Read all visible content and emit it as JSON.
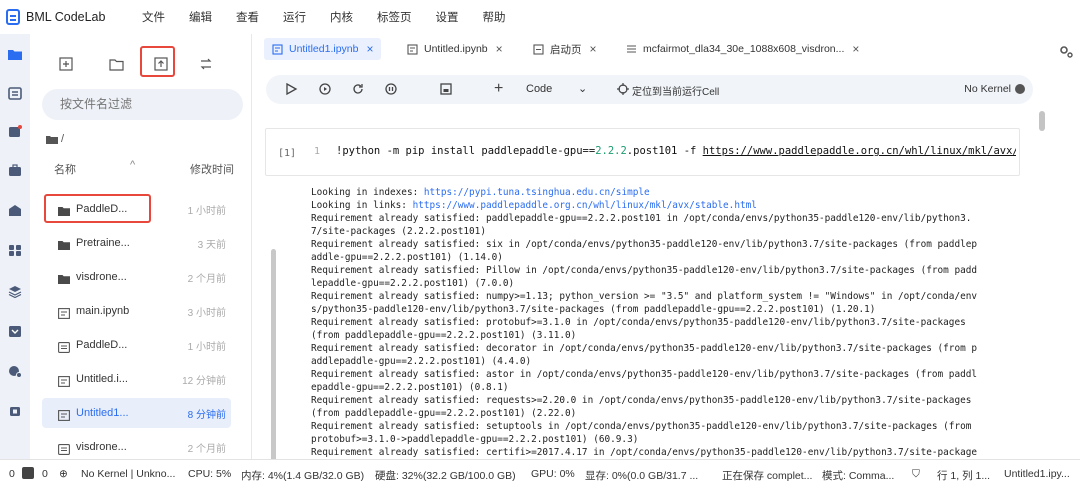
{
  "app": {
    "title": "BML CodeLab"
  },
  "menu": [
    "文件",
    "编辑",
    "查看",
    "运行",
    "内核",
    "标签页",
    "设置",
    "帮助"
  ],
  "filepanel": {
    "filter_placeholder": "按文件名过滤",
    "breadcrumb": "/",
    "col_name": "名称",
    "col_modified": "修改时间",
    "files": [
      {
        "name": "PaddleD...",
        "modified": "1 小时前",
        "type": "folder"
      },
      {
        "name": "Pretraine...",
        "modified": "3 天前",
        "type": "folder"
      },
      {
        "name": "visdrone...",
        "modified": "2 个月前",
        "type": "folder"
      },
      {
        "name": "main.ipynb",
        "modified": "3 小时前",
        "type": "notebook"
      },
      {
        "name": "PaddleD...",
        "modified": "1 小时前",
        "type": "document"
      },
      {
        "name": "Untitled.i...",
        "modified": "12 分钟前",
        "type": "notebook"
      },
      {
        "name": "Untitled1...",
        "modified": "8 分钟前",
        "type": "notebook",
        "selected": true
      },
      {
        "name": "visdrone...",
        "modified": "2 个月前",
        "type": "document"
      }
    ]
  },
  "tabs": [
    {
      "label": "Untitled1.ipynb",
      "active": true,
      "icon": "notebook-icon"
    },
    {
      "label": "Untitled.ipynb",
      "icon": "notebook-icon"
    },
    {
      "label": "启动页",
      "icon": "launcher-icon"
    },
    {
      "label": "mcfairmot_dla34_30e_1088x608_visdron...",
      "icon": "text-file-icon"
    }
  ],
  "toolbar": {
    "cell_type": "Code",
    "locate_label": "定位到当前运行Cell",
    "kernel": "No Kernel"
  },
  "cell": {
    "prompt": "[1]",
    "line_no": "1",
    "code_pre": "!python -m pip install paddlepaddle-gpu==",
    "code_num": "2.2.2",
    "code_mid": ".post101 -f ",
    "code_url": "https://www.paddlepaddle.org.cn/whl/linux/mkl/avx/stabl"
  },
  "output": [
    {
      "pre": "Looking in indexes: ",
      "link": "https://pypi.tuna.tsinghua.edu.cn/simple"
    },
    {
      "pre": "Looking in links: ",
      "link": "https://www.paddlepaddle.org.cn/whl/linux/mkl/avx/stable.html"
    },
    {
      "pre": "Requirement already satisfied: paddlepaddle-gpu==2.2.2.post101 in /opt/conda/envs/python35-paddle120-env/lib/python3."
    },
    {
      "pre": "7/site-packages (2.2.2.post101)"
    },
    {
      "pre": "Requirement already satisfied: six in /opt/conda/envs/python35-paddle120-env/lib/python3.7/site-packages (from paddlep"
    },
    {
      "pre": "addle-gpu==2.2.2.post101) (1.14.0)"
    },
    {
      "pre": "Requirement already satisfied: Pillow in /opt/conda/envs/python35-paddle120-env/lib/python3.7/site-packages (from padd"
    },
    {
      "pre": "lepaddle-gpu==2.2.2.post101) (7.0.0)"
    },
    {
      "pre": "Requirement already satisfied: numpy>=1.13; python_version >= \"3.5\" and platform_system != \"Windows\" in /opt/conda/env"
    },
    {
      "pre": "s/python35-paddle120-env/lib/python3.7/site-packages (from paddlepaddle-gpu==2.2.2.post101) (1.20.1)"
    },
    {
      "pre": "Requirement already satisfied: protobuf>=3.1.0 in /opt/conda/envs/python35-paddle120-env/lib/python3.7/site-packages"
    },
    {
      "pre": "(from paddlepaddle-gpu==2.2.2.post101) (3.11.0)"
    },
    {
      "pre": "Requirement already satisfied: decorator in /opt/conda/envs/python35-paddle120-env/lib/python3.7/site-packages (from p"
    },
    {
      "pre": "addlepaddle-gpu==2.2.2.post101) (4.4.0)"
    },
    {
      "pre": "Requirement already satisfied: astor in /opt/conda/envs/python35-paddle120-env/lib/python3.7/site-packages (from paddl"
    },
    {
      "pre": "epaddle-gpu==2.2.2.post101) (0.8.1)"
    },
    {
      "pre": "Requirement already satisfied: requests>=2.20.0 in /opt/conda/envs/python35-paddle120-env/lib/python3.7/site-packages"
    },
    {
      "pre": "(from paddlepaddle-gpu==2.2.2.post101) (2.22.0)"
    },
    {
      "pre": "Requirement already satisfied: setuptools in /opt/conda/envs/python35-paddle120-env/lib/python3.7/site-packages (from"
    },
    {
      "pre": "protobuf>=3.1.0->paddlepaddle-gpu==2.2.2.post101) (60.9.3)"
    },
    {
      "pre": "Requirement already satisfied: certifi>=2017.4.17 in /opt/conda/envs/python35-paddle120-env/lib/python3.7/site-package"
    }
  ],
  "status": {
    "count1": "0",
    "count2": "0",
    "kernel": "No Kernel | Unkno...",
    "cpu": "CPU:  5%",
    "mem": "内存:  4%(1.4 GB/32.0 GB)",
    "disk": "硬盘:  32%(32.2 GB/100.0 GB)",
    "gpu": "GPU:  0%",
    "vram": "显存:  0%(0.0 GB/31.7 ...",
    "saving": "正在保存 complet...",
    "mode": "模式:  Comma...",
    "position": "行 1, 列 1...",
    "file": "Untitled1.ipy..."
  },
  "colors": {
    "accent": "#2b6df0",
    "highlight_box": "#e8473c"
  }
}
